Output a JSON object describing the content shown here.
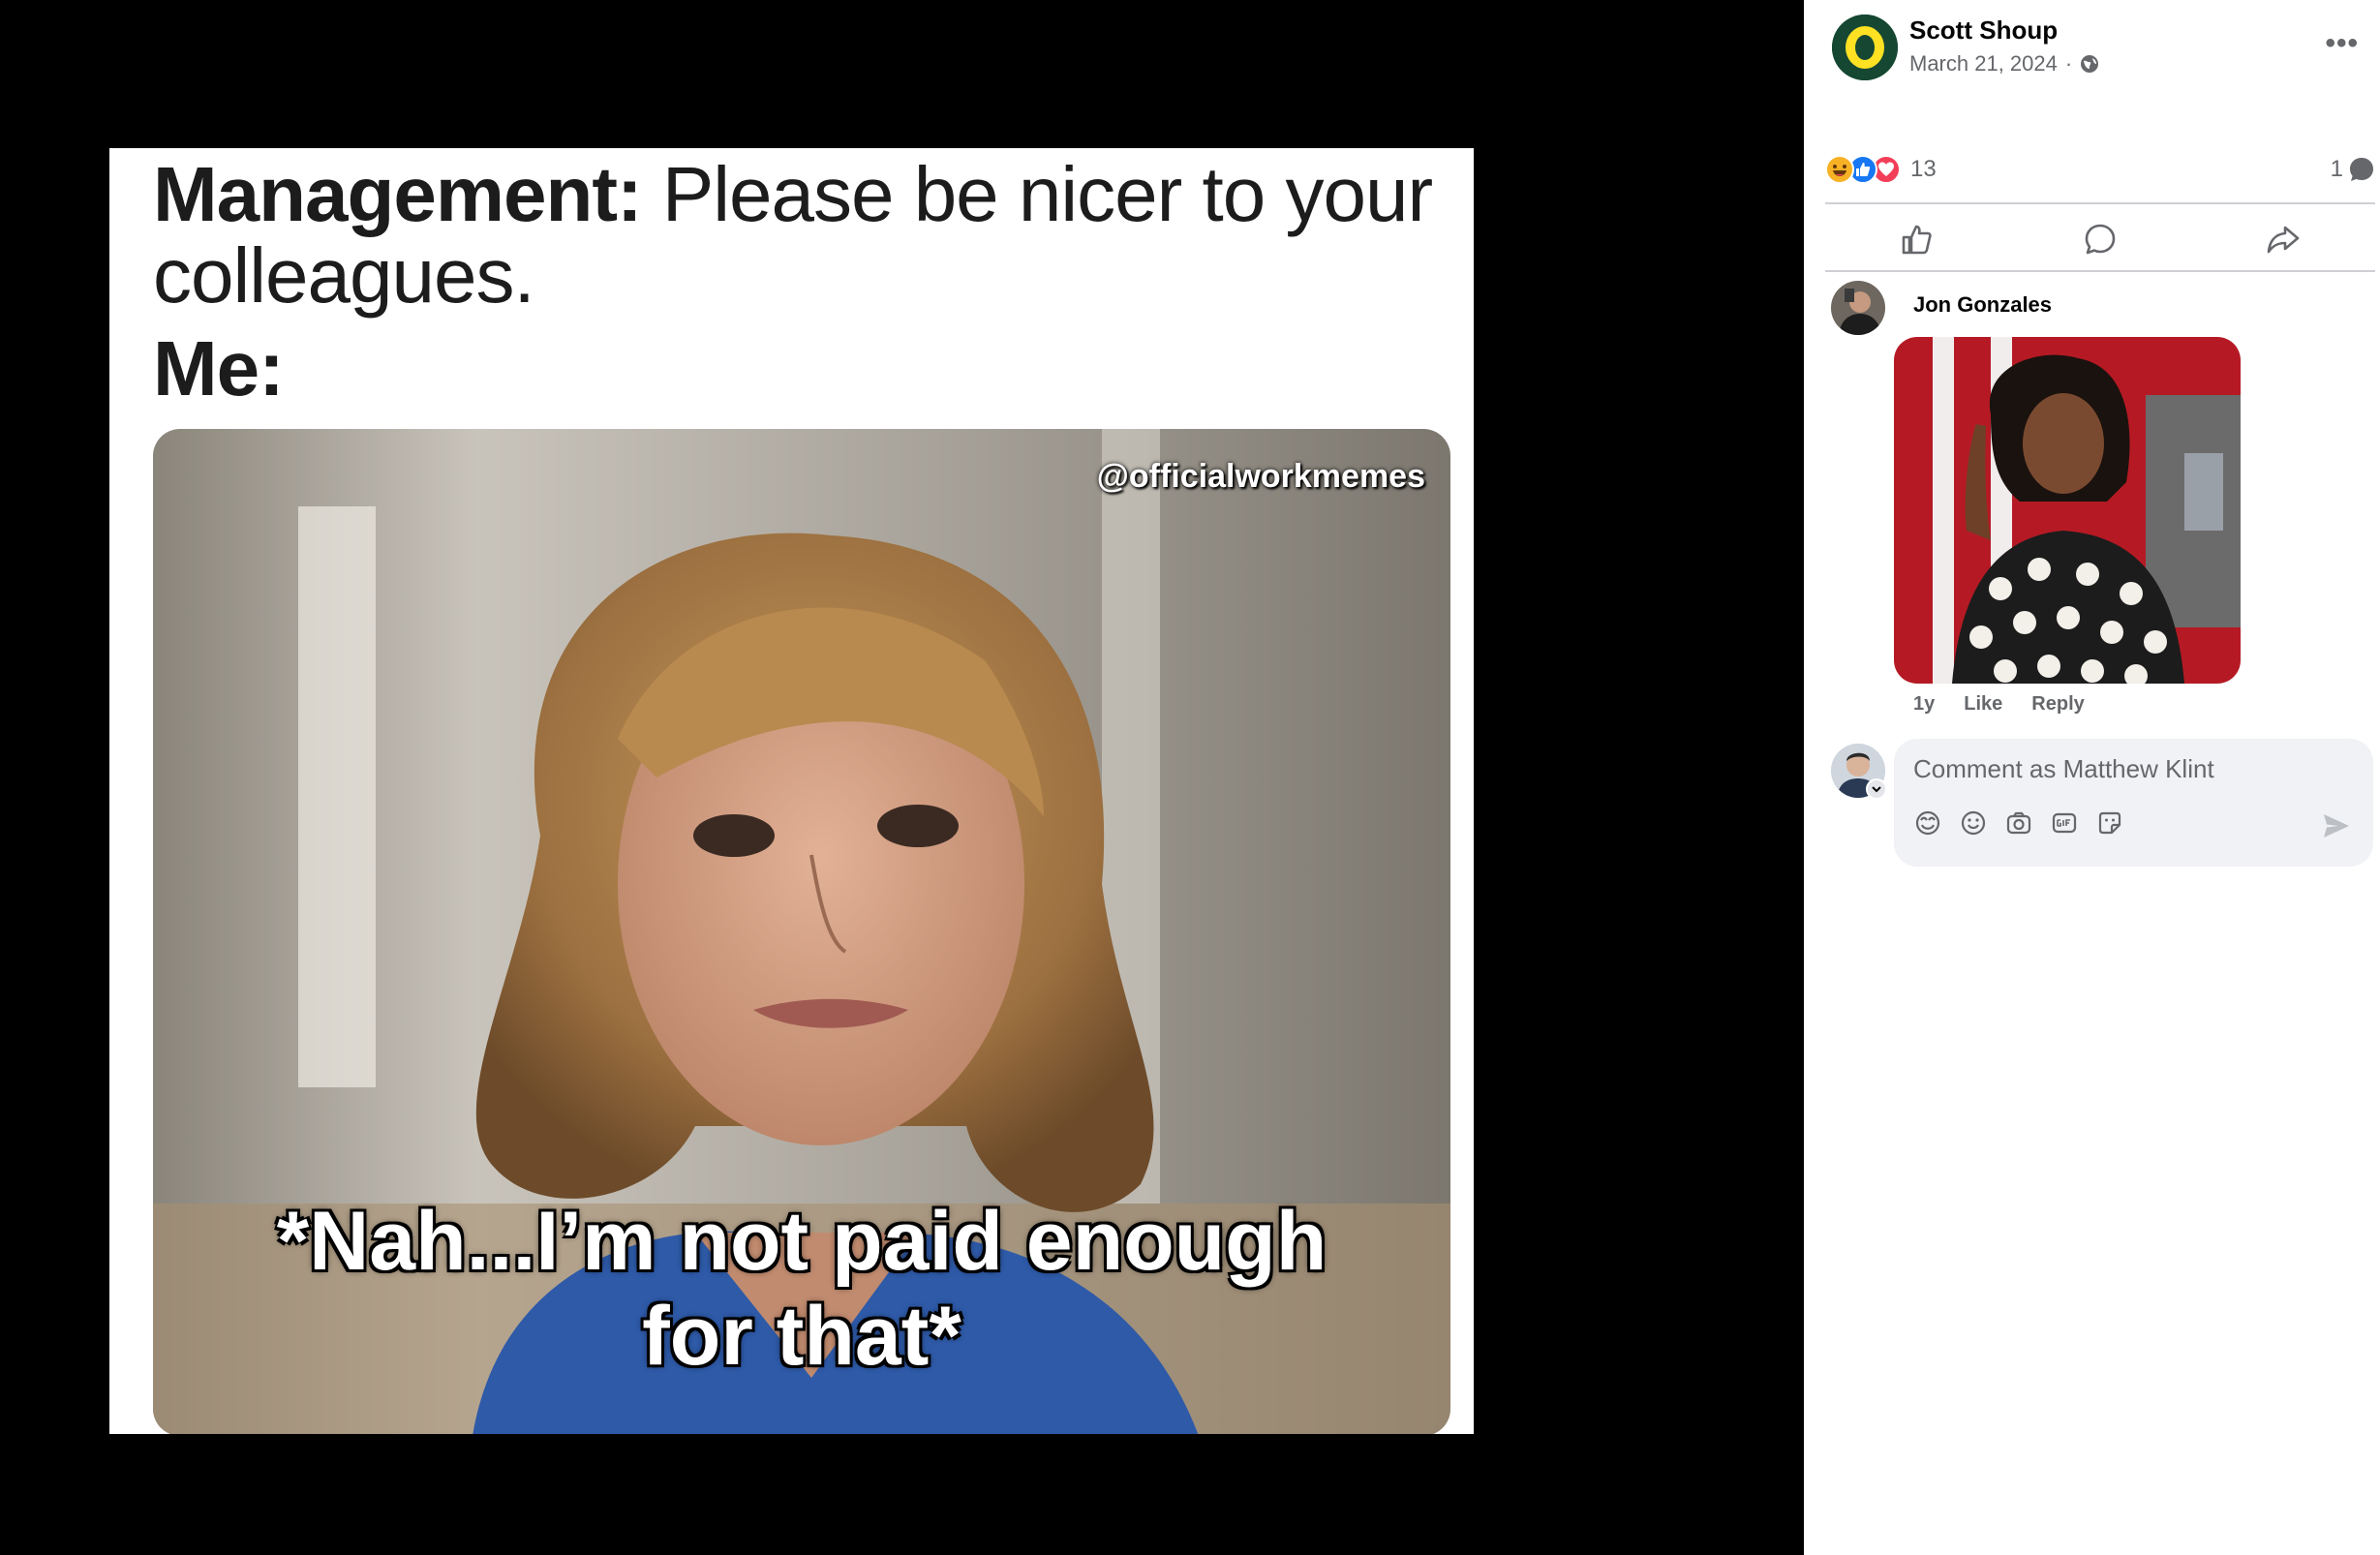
{
  "meme": {
    "line1_bold": "Management:",
    "line1_rest": " Please be nicer to your",
    "line2": "colleagues.",
    "line3": "Me:",
    "watermark": "@officialworkmemes",
    "caption_line1": "*Nah...I’m not paid enough",
    "caption_line2": "for that*"
  },
  "post": {
    "author": "Scott Shoup",
    "date": "March 21, 2024",
    "separator": "·",
    "visibility_icon": "globe-icon",
    "more_icon": "more-options-icon",
    "more_label": "•••",
    "reaction_icons": [
      "haha-icon",
      "like-icon",
      "love-icon"
    ],
    "reaction_count": "13",
    "comment_count": "1"
  },
  "actions": {
    "icons": [
      "like-icon",
      "comment-icon",
      "share-icon"
    ]
  },
  "comment": {
    "author": "Jon Gonzales",
    "time": "1y",
    "like_label": "Like",
    "reply_label": "Reply"
  },
  "composer": {
    "placeholder": "Comment as Matthew Klint",
    "icons": [
      "avatar-sticker-icon",
      "emoji-icon",
      "camera-icon",
      "gif-icon",
      "sticker-icon"
    ],
    "send_icon": "send-icon"
  },
  "colors": {
    "author_avatar_bg": "#154733",
    "author_avatar_ring": "#FEE123",
    "like_blue": "#1877F2",
    "love_red": "#F33E58",
    "haha_yellow": "#F7B125",
    "secondary_text": "#65676B",
    "composer_bg": "#F0F2F5"
  }
}
